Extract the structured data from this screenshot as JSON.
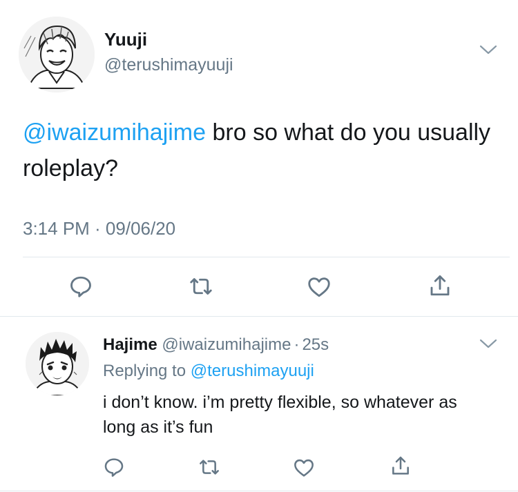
{
  "main_tweet": {
    "display_name": "Yuuji",
    "handle": "@terushimayuuji",
    "text_mention": "@iwaizumihajime",
    "text_body": " bro so what do you usually roleplay?",
    "timestamp": "3:14 PM · 09/06/20"
  },
  "reply_tweet": {
    "display_name": "Hajime",
    "handle": "@iwaizumihajime",
    "separator": "·",
    "time_ago": "25s",
    "replying_to_label": "Replying to",
    "replying_to_handle": "@terushimayuuji",
    "text": "i don’t know. i’m pretty flexible, so whatever as long as it’s fun"
  },
  "colors": {
    "text": "#14171a",
    "secondary": "#657786",
    "link": "#1da1f2",
    "divider": "#e1e8ed"
  },
  "icons": [
    "reply-icon",
    "retweet-icon",
    "like-icon",
    "share-icon",
    "chevron-down-icon"
  ]
}
